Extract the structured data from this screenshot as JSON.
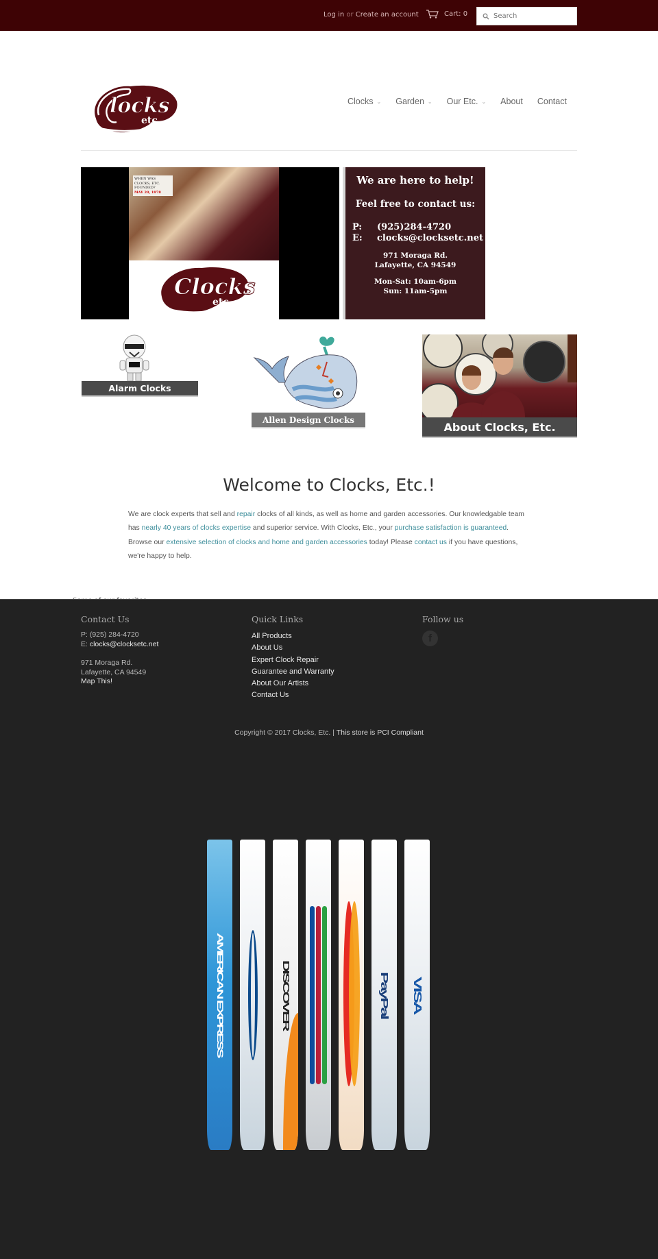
{
  "topbar": {
    "login": "Log in",
    "or": "or",
    "create_account": "Create an account",
    "cart_label": "Cart: 0",
    "search_placeholder": "Search"
  },
  "header": {
    "logo_alt": "Clocks etc.",
    "nav": [
      {
        "label": "Clocks",
        "has_dropdown": true
      },
      {
        "label": "Garden",
        "has_dropdown": true
      },
      {
        "label": "Our Etc.",
        "has_dropdown": true
      },
      {
        "label": "About",
        "has_dropdown": false
      },
      {
        "label": "Contact",
        "has_dropdown": false
      }
    ]
  },
  "hero": {
    "photo_note": "WHEN WAS CLOCKS, ETC. FOUNDED?",
    "photo_note_date": "MAY 20, 1978",
    "info": {
      "title": "We are here to help!",
      "subtitle": "Feel free to contact us:",
      "phone_key": "P:",
      "phone": "(925)284-4720",
      "email_key": "E:",
      "email": "clocks@clocksetc.net",
      "address_line1": "971 Moraga Rd.",
      "address_line2": "Lafayette, CA 94549",
      "hours_line1": "Mon-Sat: 10am-6pm",
      "hours_line2": "Sun: 11am-5pm"
    }
  },
  "tiles": [
    {
      "label": "Alarm Clocks"
    },
    {
      "label": "Allen Design Clocks"
    },
    {
      "label": "About Clocks, Etc."
    }
  ],
  "welcome": {
    "title": "Welcome to Clocks, Etc.!",
    "t1": "We are clock experts that sell and ",
    "l1": "repair",
    "t2": " clocks of all kinds, as well as home and garden accessories. Our knowledgable team has ",
    "l2": "nearly 40 years of clocks expertise",
    "t3": " and superior service. With Clocks, Etc., your ",
    "l3": "purchase satisfaction is guaranteed",
    "t4": ". Browse our ",
    "l4": "extensive selection of clocks and home and garden accessories",
    "t5": " today! Please ",
    "l5": "contact us",
    "t6": " if you have questions, we're happy to help."
  },
  "favorites_label": "Some of our favorites...",
  "footer": {
    "contact": {
      "title": "Contact Us",
      "phone": "P: (925) 284-4720",
      "email_prefix": "E: ",
      "email": "clocks@clocksetc.net",
      "address_line1": "971 Moraga Rd.",
      "address_line2": "Lafayette, CA 94549",
      "map_link": "Map This!"
    },
    "quick_links": {
      "title": "Quick Links",
      "items": [
        "All Products",
        "About Us",
        "Expert Clock Repair",
        "Guarantee and Warranty",
        "About Our Artists",
        "Contact Us"
      ]
    },
    "follow": {
      "title": "Follow us",
      "facebook_glyph": "f"
    },
    "copyright": "Copyright © 2017 Clocks, Etc. | ",
    "pci_link": "This store is PCI Compliant",
    "payment_cards": [
      "AMERICAN EXPRESS",
      "Diners Club",
      "DISCOVER",
      "JCB",
      "MasterCard",
      "PayPal",
      "VISA"
    ]
  },
  "colors": {
    "topbar_bg": "#3e0305",
    "brand_maroon": "#5a0e14",
    "hero_info_bg": "#3c1a1e",
    "link_teal": "#3f8f9c",
    "footer_bg": "#222222"
  }
}
